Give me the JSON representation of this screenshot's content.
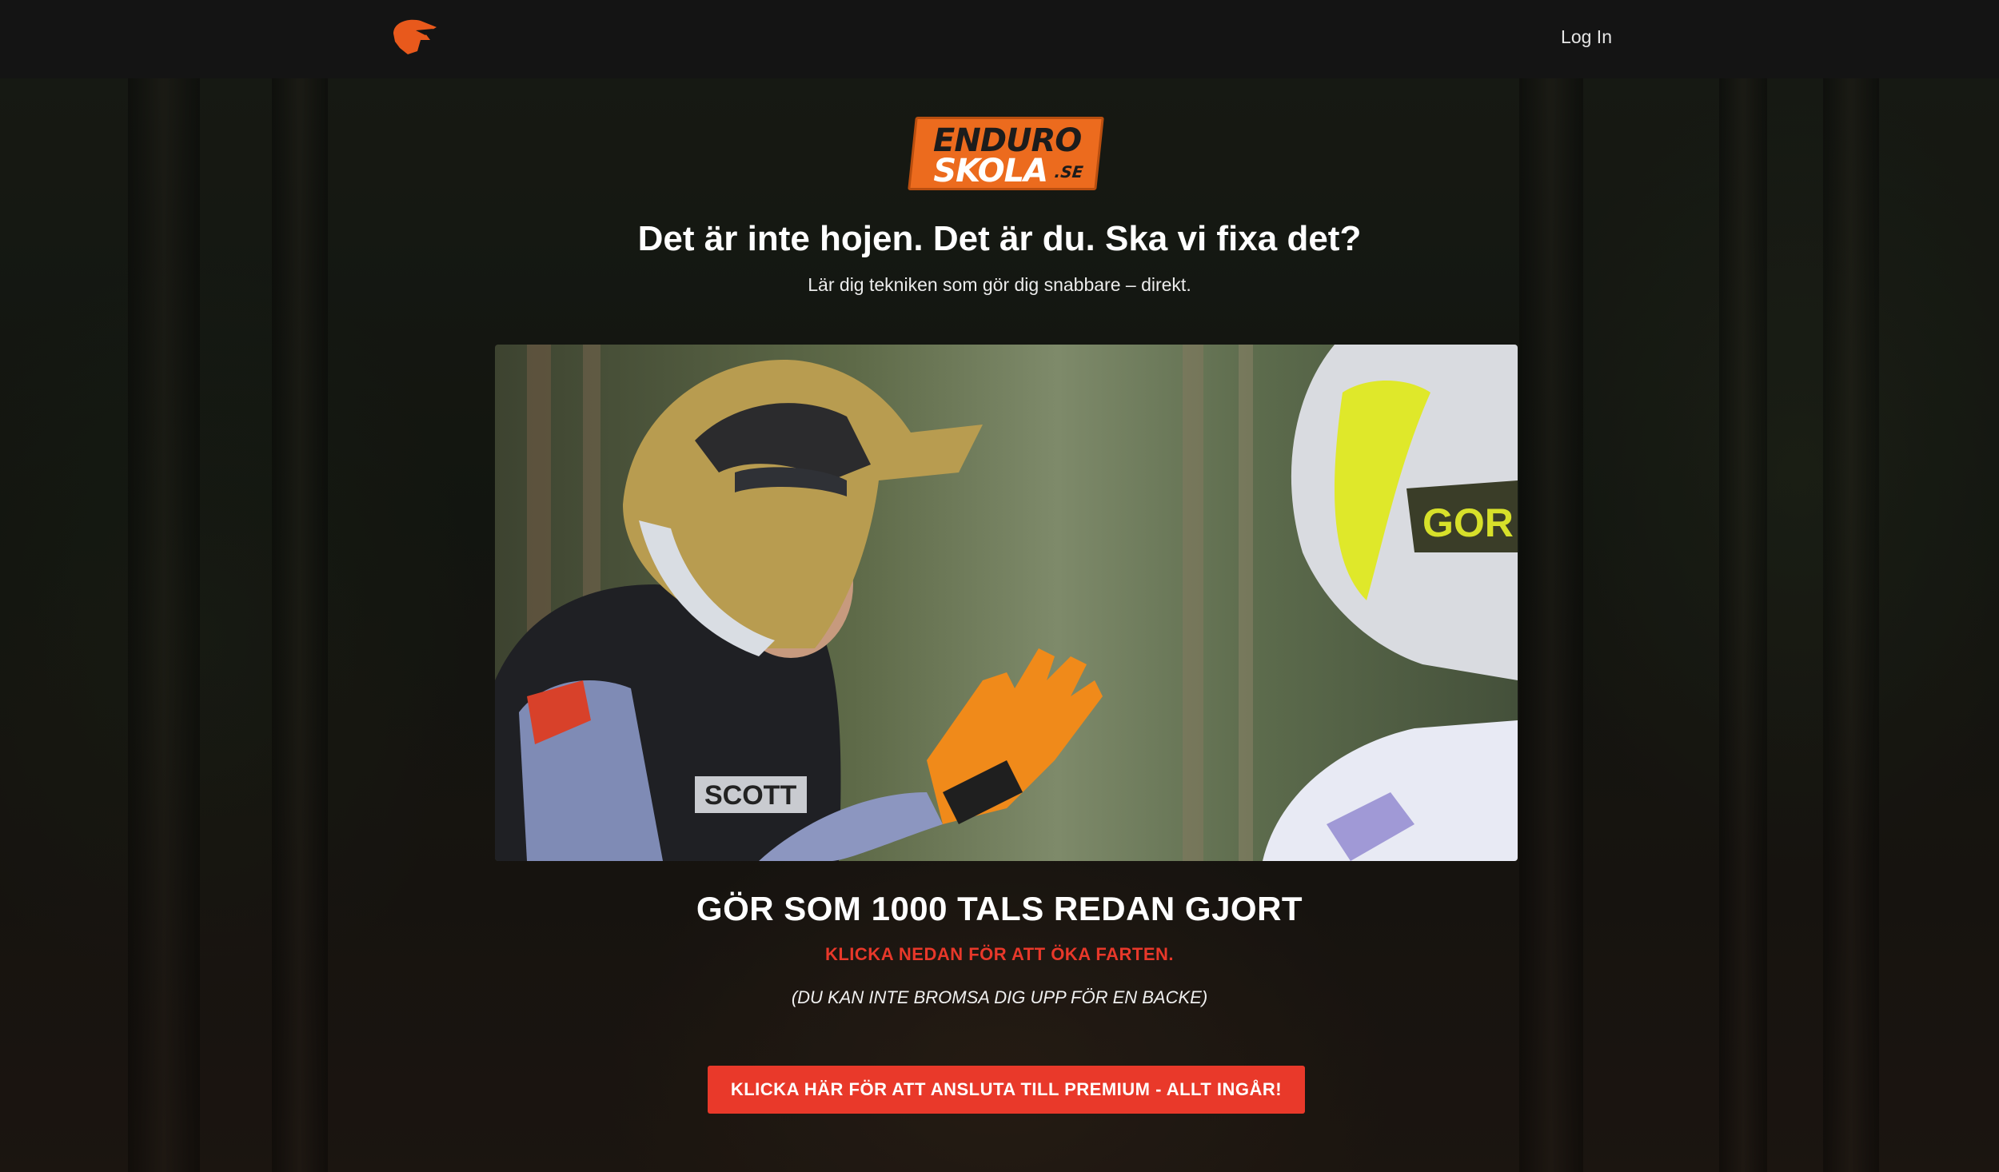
{
  "nav": {
    "brand_icon": "helmet-icon",
    "login_label": "Log In"
  },
  "logo": {
    "line1": "ENDURO",
    "line2": "SKOLA",
    "suffix": ".SE"
  },
  "hero": {
    "headline": "Det är inte hojen. Det är du. Ska vi fixa det?",
    "subline": "Lär dig tekniken som gör dig snabbare – direkt."
  },
  "cta": {
    "title": "GÖR SOM 1000 TALS REDAN GJORT",
    "red_text": "KLICKA NEDAN FÖR ATT ÖKA FARTEN.",
    "note": "(DU KAN INTE BROMSA DIG UPP FÖR EN BACKE)",
    "button_label": "KLICKA HÄR FÖR ATT ANSLUTA TILL PREMIUM - ALLT INGÅR!"
  },
  "colors": {
    "accent": "#ec6b1e",
    "cta_red": "#e9392a",
    "topbar": "#141414"
  }
}
